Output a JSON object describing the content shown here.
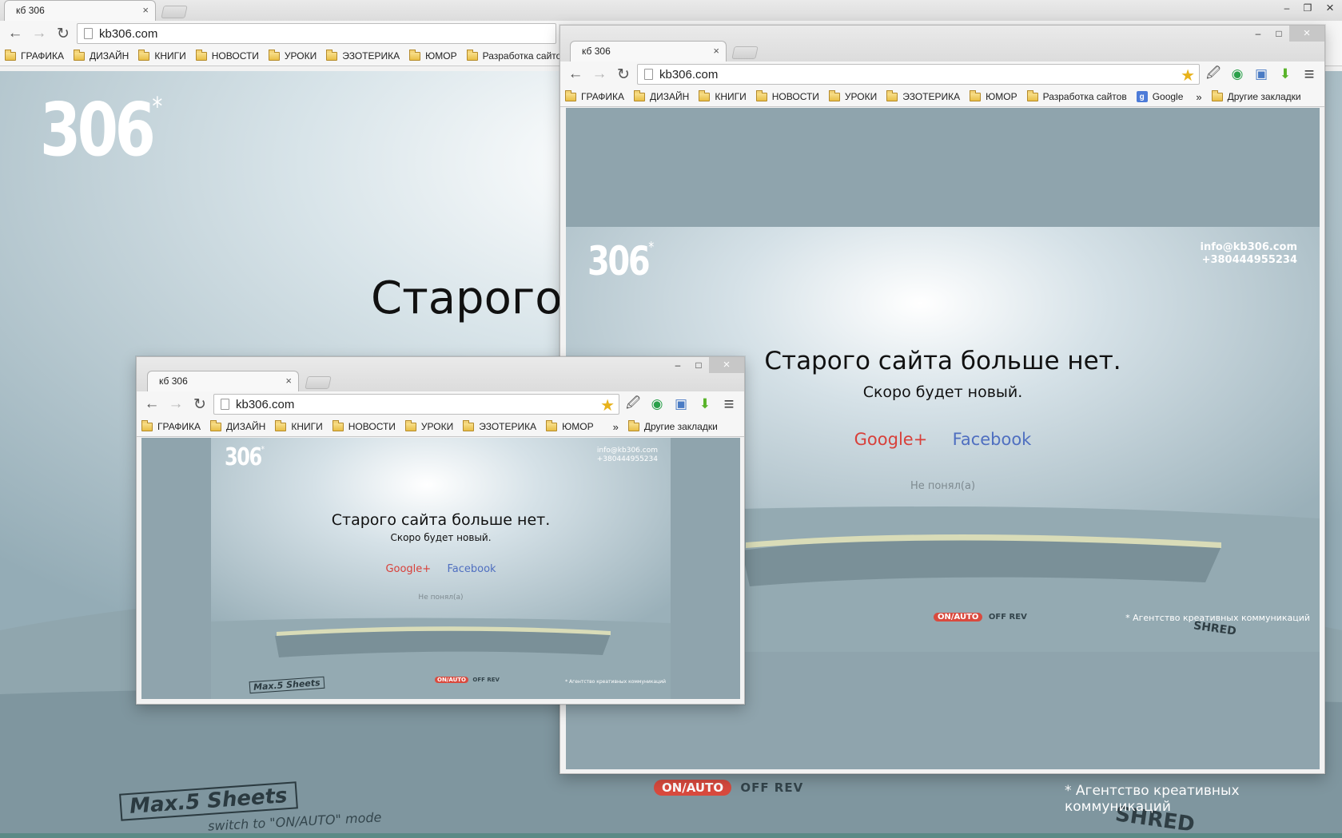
{
  "colors": {
    "accent_google": "#d8403a",
    "accent_facebook": "#4f6fc0",
    "page_gray": "#8fa5ae"
  },
  "tab": {
    "title": "кб 306",
    "close": "×"
  },
  "address": "kb306.com",
  "win_controls": {
    "minimize": "–",
    "maximize": "□",
    "restore": "❐",
    "close": "×"
  },
  "nav": {
    "back": "←",
    "forward": "→",
    "reload": "↻"
  },
  "icons": {
    "star": "★",
    "eyedropper": "🖉",
    "color_wheel": "◉",
    "screenshot": "▣",
    "download": "⬇",
    "menu": "≡"
  },
  "bookmarks": [
    "ГРАФИКА",
    "ДИЗАЙН",
    "КНИГИ",
    "НОВОСТИ",
    "УРОКИ",
    "ЭЗОТЕРИКА",
    "ЮМОР",
    "Разработка сайтов"
  ],
  "bookmark_google": "Google",
  "bookmark_more": "»",
  "bookmark_other": "Другие закладки",
  "site": {
    "logo": "306",
    "logo_mark": "*",
    "email": "info@kb306.com",
    "phone": "+380444955234",
    "headline": "Старого сайта больше нет.",
    "headline_partial": "Старого",
    "subtitle": "Скоро будет новый.",
    "google_plus": "Google+",
    "facebook": "Facebook",
    "didnt_understand": "Не понял(а)",
    "agency": "* Агентство креативных коммуникаций",
    "machine_label": "Max.5 Sheets",
    "machine_mode": "switch to \"ON/AUTO\" mode",
    "machine_switch": "ON/AUTO",
    "machine_switch2": "OFF REV",
    "machine_brand": "SHRED"
  }
}
